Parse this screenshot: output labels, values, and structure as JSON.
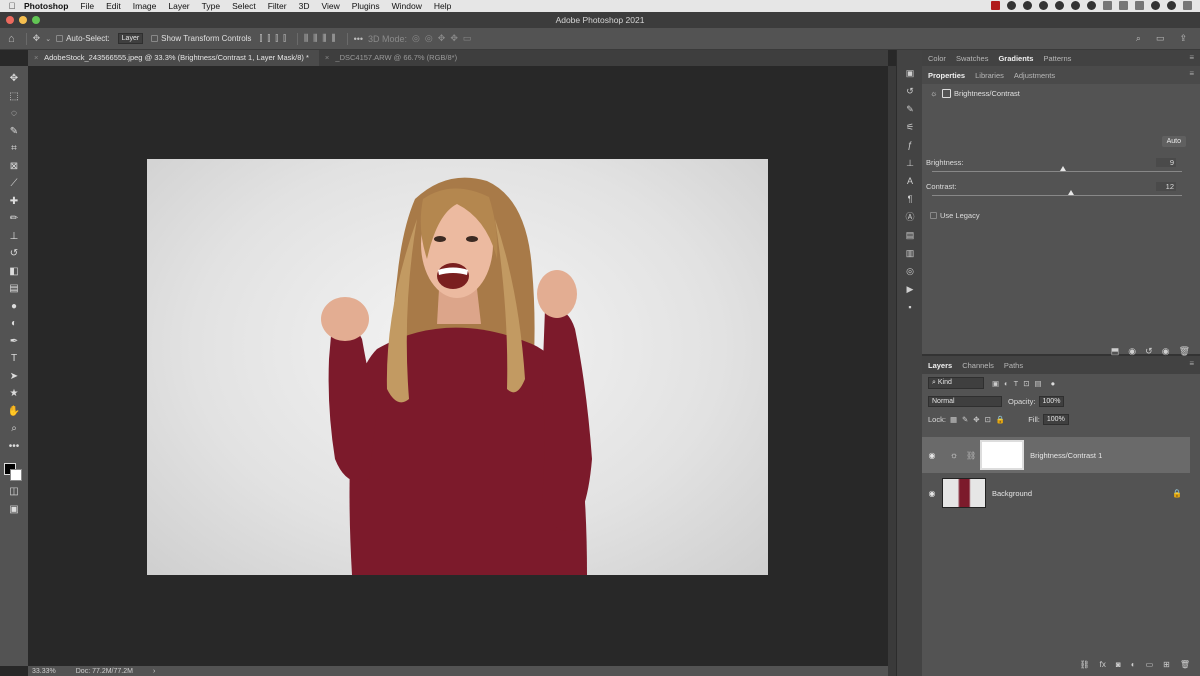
{
  "menubar": {
    "apple": "",
    "app_name": "Photoshop",
    "items": [
      "File",
      "Edit",
      "Image",
      "Layer",
      "Type",
      "Select",
      "Filter",
      "3D",
      "View",
      "Plugins",
      "Window",
      "Help"
    ]
  },
  "window": {
    "title": "Adobe Photoshop 2021"
  },
  "options": {
    "auto_select_label": "Auto-Select:",
    "auto_select_value": "Layer",
    "show_transform_label": "Show Transform Controls",
    "more": "•••",
    "mode_3d": "3D Mode:"
  },
  "tabs": [
    {
      "label": "AdobeStock_243566555.jpeg @ 33.3% (Brightness/Contrast 1, Layer Mask/8) *",
      "active": true
    },
    {
      "label": "_DSC4157.ARW @ 66.7% (RGB/8*)",
      "active": false
    }
  ],
  "status": {
    "zoom": "33.33%",
    "doc": "Doc: 77.2M/77.2M",
    "arrow": "›"
  },
  "panels": {
    "top_tabs": [
      "Color",
      "Swatches",
      "Gradients",
      "Patterns"
    ],
    "top_active": "Gradients",
    "prop_tabs": [
      "Properties",
      "Libraries",
      "Adjustments"
    ],
    "prop_active": "Properties",
    "adjustment_name": "Brightness/Contrast",
    "auto_label": "Auto",
    "brightness_label": "Brightness:",
    "brightness_value": "9",
    "contrast_label": "Contrast:",
    "contrast_value": "12",
    "use_legacy_label": "Use Legacy"
  },
  "layers_panel": {
    "tabs": [
      "Layers",
      "Channels",
      "Paths"
    ],
    "active": "Layers",
    "kind_label": "Kind",
    "blend_mode": "Normal",
    "opacity_label": "Opacity:",
    "opacity_value": "100%",
    "lock_label": "Lock:",
    "fill_label": "Fill:",
    "fill_value": "100%",
    "layers": [
      {
        "name": "Brightness/Contrast 1",
        "selected": true
      },
      {
        "name": "Background",
        "selected": false
      }
    ]
  },
  "colors": {
    "sweater": "#7c1a2b",
    "hair": "#b08350",
    "skin": "#e8b59a",
    "traffic_red": "#ed6a5e",
    "traffic_yellow": "#f5bf4f",
    "traffic_green": "#62c554"
  }
}
